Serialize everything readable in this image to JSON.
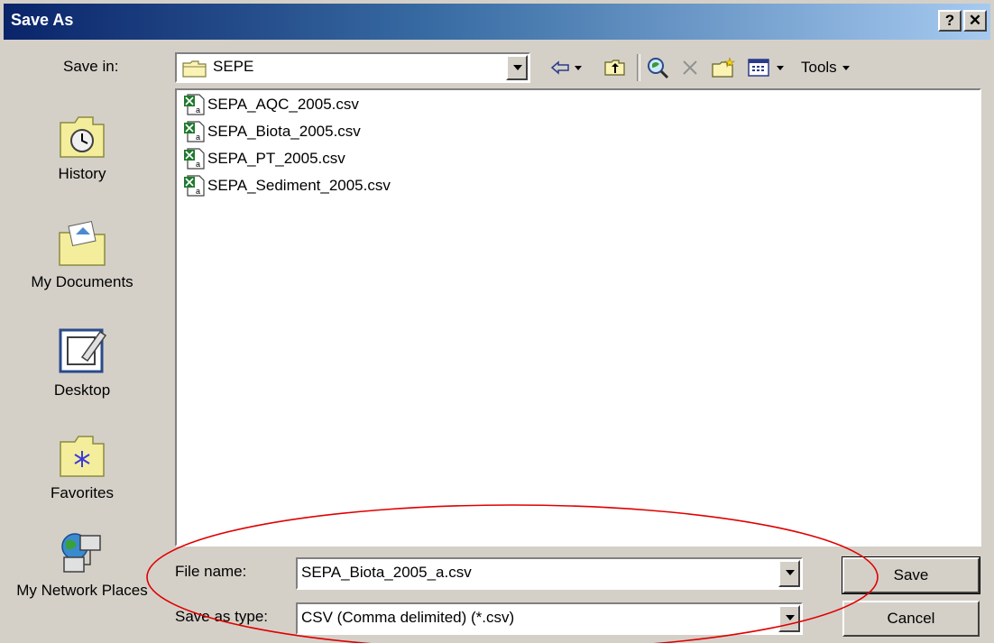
{
  "window": {
    "title": "Save As",
    "help_label": "?",
    "close_label": "✕"
  },
  "save_in": {
    "label": "Save in:",
    "value": "SEPE"
  },
  "toolbar": {
    "tools_label": "Tools",
    "icons": [
      "back-icon",
      "up-folder-icon",
      "search-web-icon",
      "delete-icon",
      "new-folder-icon",
      "views-icon"
    ]
  },
  "places": [
    {
      "label": "History",
      "icon": "history-icon"
    },
    {
      "label": "My Documents",
      "icon": "my-documents-icon"
    },
    {
      "label": "Desktop",
      "icon": "desktop-icon"
    },
    {
      "label": "Favorites",
      "icon": "favorites-icon"
    },
    {
      "label": "My Network Places",
      "icon": "network-places-icon"
    }
  ],
  "files": [
    {
      "name": "SEPA_AQC_2005.csv"
    },
    {
      "name": "SEPA_Biota_2005.csv"
    },
    {
      "name": "SEPA_PT_2005.csv"
    },
    {
      "name": "SEPA_Sediment_2005.csv"
    }
  ],
  "file_name": {
    "label": "File name:",
    "value": "SEPA_Biota_2005_a.csv"
  },
  "save_as_type": {
    "label": "Save as type:",
    "value": "CSV (Comma delimited) (*.csv)"
  },
  "buttons": {
    "save": "Save",
    "cancel": "Cancel"
  },
  "colors": {
    "title_start": "#0a246a",
    "title_end": "#a6caf0",
    "dialog_bg": "#d4d0c8",
    "annotation": "#e00000"
  }
}
